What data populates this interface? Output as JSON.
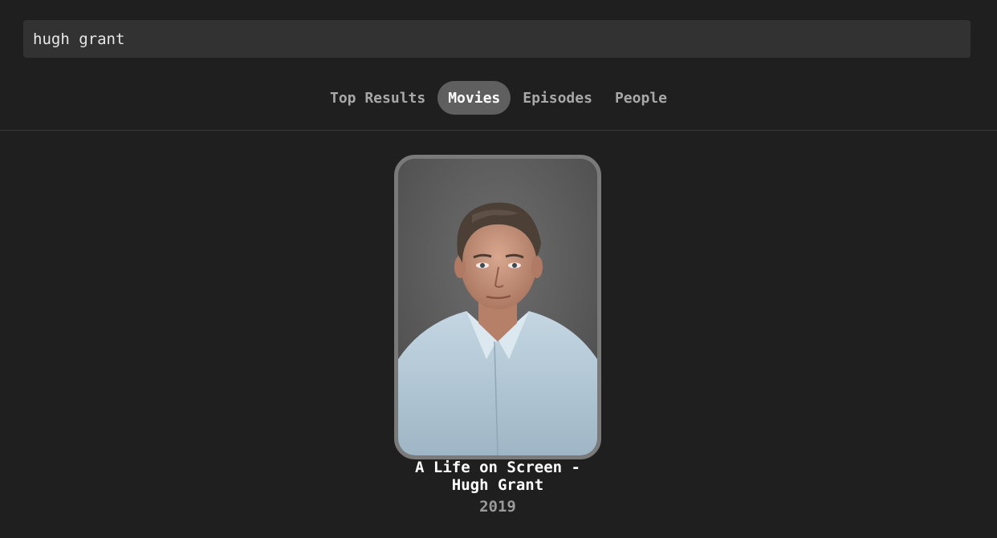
{
  "search": {
    "value": "hugh grant"
  },
  "tabs": [
    {
      "label": "Top Results",
      "active": false
    },
    {
      "label": "Movies",
      "active": true
    },
    {
      "label": "Episodes",
      "active": false
    },
    {
      "label": "People",
      "active": false
    }
  ],
  "results": [
    {
      "title": "A Life on Screen - Hugh Grant",
      "year": "2019"
    }
  ],
  "colors": {
    "background": "#1f1f1f",
    "search_bg": "#323232",
    "active_tab_bg": "#5f5f5f",
    "poster_border": "#7a7a7a"
  }
}
